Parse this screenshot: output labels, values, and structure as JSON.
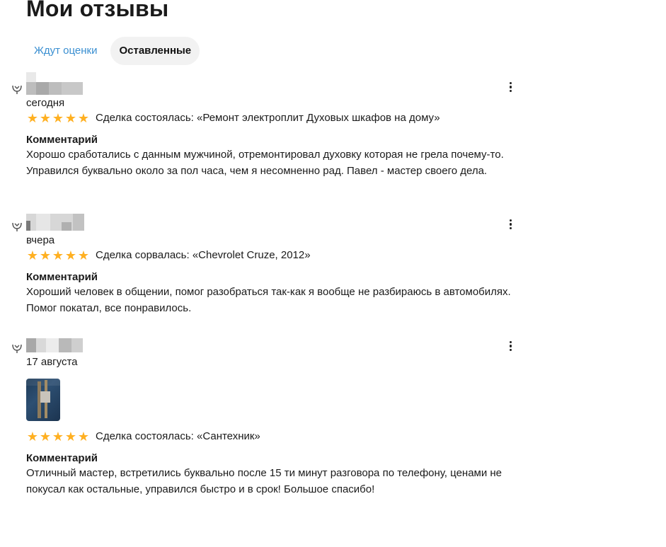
{
  "page": {
    "title": "Мои отзывы"
  },
  "tabs": [
    {
      "label": "Ждут оценки",
      "active": false
    },
    {
      "label": "Оставленные",
      "active": true
    }
  ],
  "reviews": [
    {
      "date": "сегодня",
      "rating": 5,
      "stars": [
        "★",
        "★",
        "★",
        "★",
        "★"
      ],
      "deal": "Сделка состоялась: «Ремонт электроплит Духовых шкафов на дому»",
      "comment_title": "Комментарий",
      "comment": "Хорошо сработались с данным мужчиной, отремонтировал духовку которая не грела почему-то. Управился буквально около за пол часа, чем я несомненно рад. Павел - мастер своего дела.",
      "has_photo": false
    },
    {
      "date": "вчера",
      "rating": 5,
      "stars": [
        "★",
        "★",
        "★",
        "★",
        "★"
      ],
      "deal": "Сделка сорвалась: «Chevrolet Cruze, 2012»",
      "comment_title": "Комментарий",
      "comment": "Хороший человек в общении, помог разобраться так-как я вообще не разбираюсь в автомобилях. Помог покатал, все понравилось.",
      "has_photo": false
    },
    {
      "date": "17 августа",
      "rating": 5,
      "stars": [
        "★",
        "★",
        "★",
        "★",
        "★"
      ],
      "deal": "Сделка состоялась: «Сантехник»",
      "comment_title": "Комментарий",
      "comment": "Отличный мастер, встретились буквально после 15 ти минут разговора по телефону, ценами не покусал как остальные, управился быстро и в срок! Большое спасибо!",
      "has_photo": true
    }
  ],
  "colors": {
    "star": "#ffb021",
    "tab_link": "#3a8fd1",
    "tab_active_bg": "#f2f2f2"
  },
  "icons": {
    "verified": "verified-badge-icon",
    "more": "more-vertical-icon",
    "star": "star-icon"
  }
}
